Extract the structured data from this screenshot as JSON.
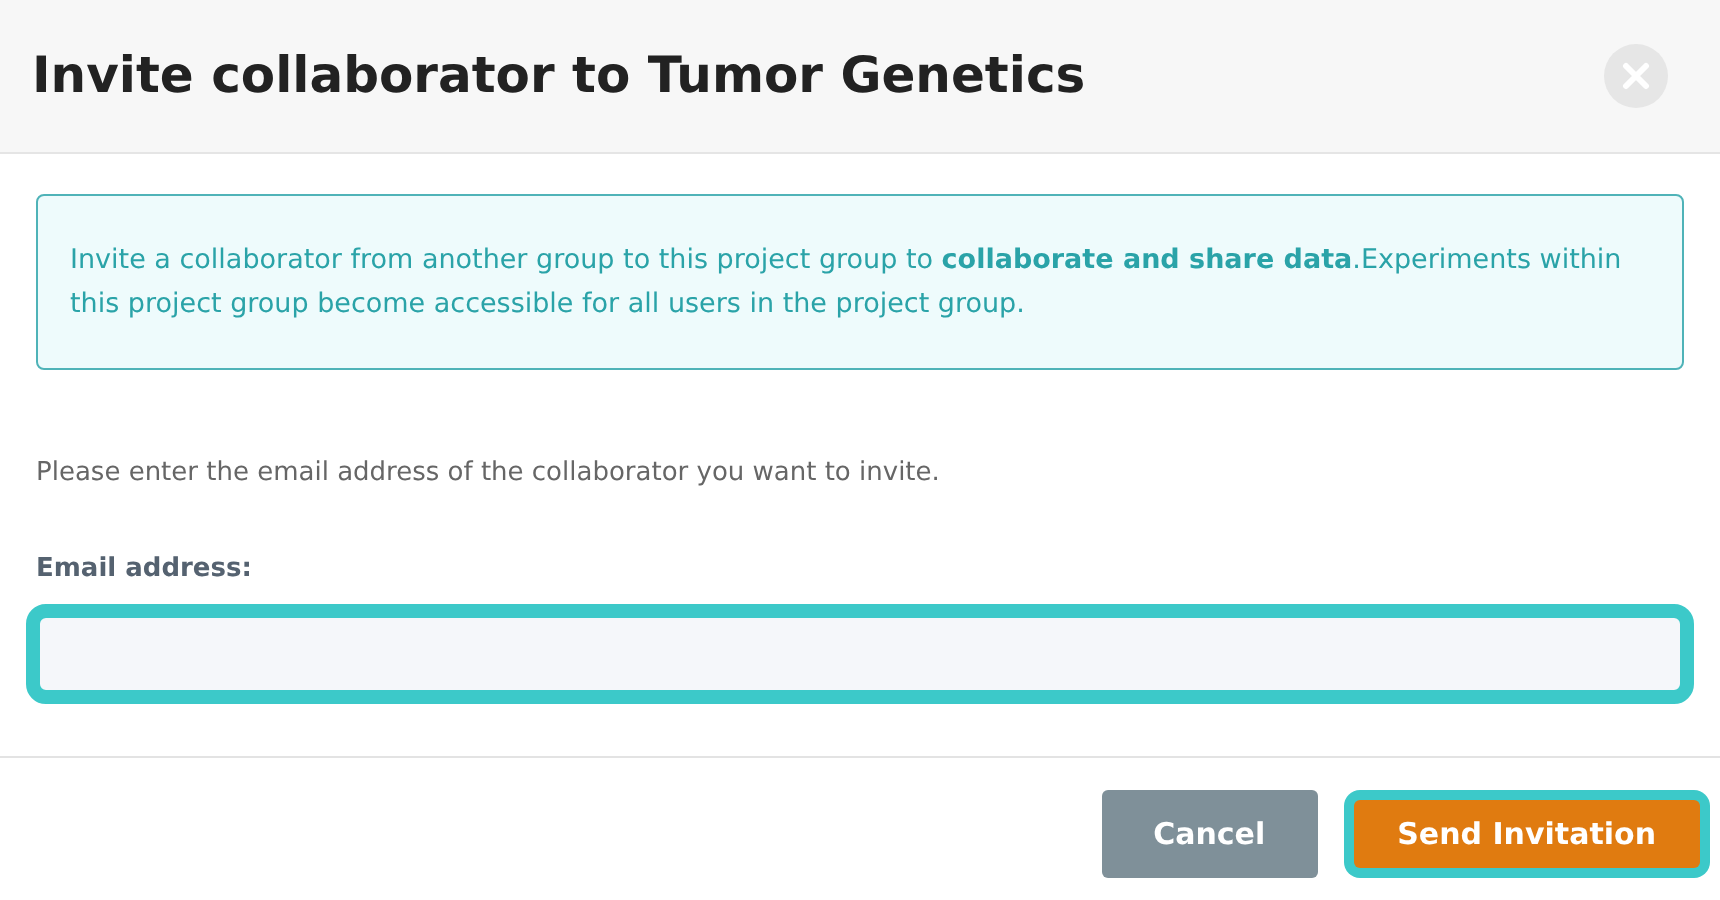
{
  "dialog": {
    "title": "Invite collaborator to Tumor Genetics"
  },
  "info": "Invite a collaborator from another group to this project group to **collaborate and share data**.Experiments within this project group become accessible for all users in the project group.",
  "description": "Please enter the email address of the collaborator you want to invite.",
  "email": {
    "label": "Email address:",
    "highlighted": true
  },
  "buttons": [
    {
      "label": "Cancel",
      "kind": "secondary",
      "highlighted": false
    },
    {
      "label": "Send Invitation",
      "kind": "primary",
      "highlighted": true
    }
  ]
}
